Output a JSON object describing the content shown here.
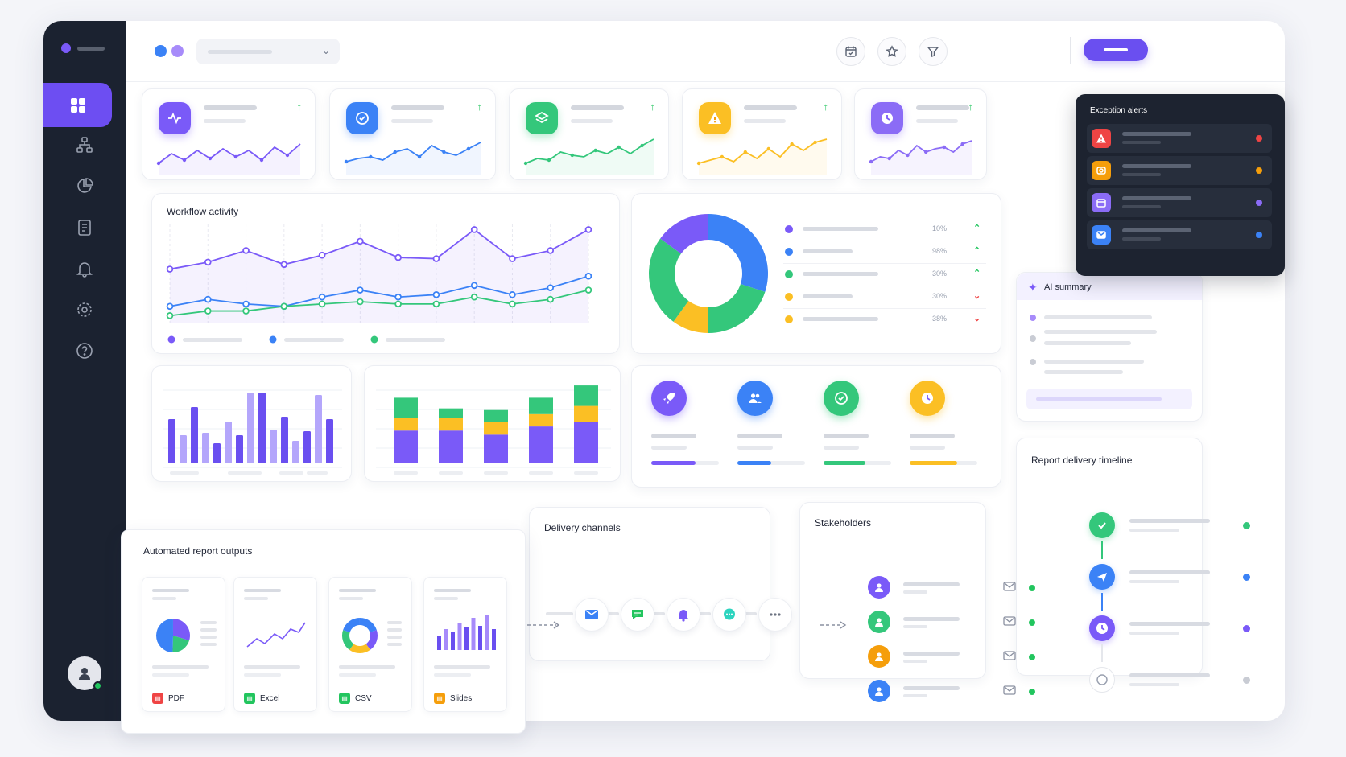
{
  "sidebar": {
    "items": [
      {
        "icon": "dashboard-icon",
        "active": true
      },
      {
        "icon": "org-chart-icon"
      },
      {
        "icon": "pie-chart-icon"
      },
      {
        "icon": "document-icon"
      },
      {
        "icon": "bell-icon"
      },
      {
        "icon": "gear-icon"
      },
      {
        "icon": "help-icon"
      }
    ],
    "avatar": {
      "icon": "user-icon",
      "status_color": "#22c55e"
    }
  },
  "header": {
    "buttons": [
      "calendar-icon",
      "star-icon",
      "filter-icon"
    ],
    "accent": "#6a4ff0"
  },
  "kpis": [
    {
      "icon": "activity-icon",
      "color": "#7a5af8",
      "trend": "↑"
    },
    {
      "icon": "check-circle-icon",
      "color": "#3b82f6",
      "trend": "↑"
    },
    {
      "icon": "layers-icon",
      "color": "#34c77b",
      "trend": "↑"
    },
    {
      "icon": "warning-icon",
      "color": "#fbbf24",
      "trend": "↑"
    },
    {
      "icon": "clock-icon",
      "color": "#8b6cf6",
      "trend": "↑"
    }
  ],
  "workflow": {
    "title": "Workflow activity"
  },
  "donut_stats": {
    "values": [
      "10%",
      "98%",
      "30%",
      "30%",
      "38%"
    ],
    "colors": [
      "#7a5af8",
      "#3b82f6",
      "#34c77b",
      "#fbbf24",
      "#fbbf24"
    ],
    "trends": [
      "up",
      "up",
      "up",
      "down",
      "down"
    ]
  },
  "exception_alerts": {
    "title": "Exception alerts",
    "items": [
      {
        "icon": "warning-icon",
        "color": "#ef4444"
      },
      {
        "icon": "camera-icon",
        "color": "#f59e0b"
      },
      {
        "icon": "calendar-icon",
        "color": "#8b6cf6"
      },
      {
        "icon": "inbox-icon",
        "color": "#3b82f6"
      }
    ]
  },
  "ai_summary": {
    "title": "AI summary"
  },
  "stats_tiles": [
    {
      "icon": "rocket-icon",
      "color": "#7a5af8",
      "progress": 0.65
    },
    {
      "icon": "users-icon",
      "color": "#3b82f6",
      "progress": 0.5
    },
    {
      "icon": "check-circle-icon",
      "color": "#34c77b",
      "progress": 0.62
    },
    {
      "icon": "clock-icon",
      "color": "#fbbf24",
      "progress": 0.7
    }
  ],
  "reports": {
    "title": "Automated report outputs",
    "formats": [
      {
        "label": "PDF",
        "color": "#ef4444"
      },
      {
        "label": "Excel",
        "color": "#22c55e"
      },
      {
        "label": "CSV",
        "color": "#22c55e"
      },
      {
        "label": "Slides",
        "color": "#f59e0b"
      }
    ]
  },
  "delivery": {
    "title": "Delivery channels",
    "channels": [
      "mail-icon",
      "chat-icon",
      "bell-icon",
      "message-icon",
      "more-icon"
    ]
  },
  "stakeholders": {
    "title": "Stakeholders",
    "people": [
      {
        "color": "#7a5af8"
      },
      {
        "color": "#34c77b"
      },
      {
        "color": "#f59e0b"
      },
      {
        "color": "#3b82f6"
      }
    ]
  },
  "timeline": {
    "title": "Report delivery timeline",
    "steps": [
      {
        "icon": "check-icon",
        "color": "#34c77b"
      },
      {
        "icon": "send-icon",
        "color": "#3b82f6"
      },
      {
        "icon": "clock-icon",
        "color": "#7a5af8"
      },
      {
        "icon": "pending-icon",
        "color": "#c9ccd4"
      }
    ]
  },
  "chart_data": [
    {
      "type": "line",
      "title": "Workflow activity",
      "series": [
        {
          "values": [
            46,
            52,
            62,
            50,
            58,
            70,
            56,
            55,
            80,
            55,
            62,
            80
          ]
        },
        {
          "values": [
            14,
            20,
            16,
            14,
            22,
            28,
            22,
            24,
            32,
            24,
            30,
            40
          ]
        },
        {
          "values": [
            6,
            10,
            10,
            14,
            16,
            18,
            16,
            16,
            22,
            16,
            20,
            28
          ]
        }
      ],
      "colors": [
        "#7a5af8",
        "#3b82f6",
        "#34c77b"
      ],
      "ylim": [
        0,
        90
      ],
      "legend": "bottom"
    },
    {
      "type": "pie",
      "values": [
        30,
        20,
        10,
        25,
        15
      ],
      "colors": [
        "#3b82f6",
        "#34c77b",
        "#fbbf24",
        "#34c77b",
        "#7a5af8"
      ]
    },
    {
      "type": "bar",
      "values": [
        55,
        35,
        70,
        38,
        25,
        52,
        35,
        88,
        88,
        42,
        58,
        28,
        40,
        85,
        55
      ],
      "ylim": [
        0,
        100
      ]
    },
    {
      "type": "bar",
      "series": [
        {
          "name": "",
          "values": [
            40,
            40,
            35,
            45,
            50
          ]
        },
        {
          "name": "",
          "values": [
            15,
            15,
            15,
            15,
            20
          ]
        },
        {
          "name": "",
          "values": [
            25,
            12,
            15,
            20,
            25
          ]
        }
      ],
      "colors": [
        "#7a5af8",
        "#fbbf24",
        "#34c77b"
      ]
    }
  ]
}
